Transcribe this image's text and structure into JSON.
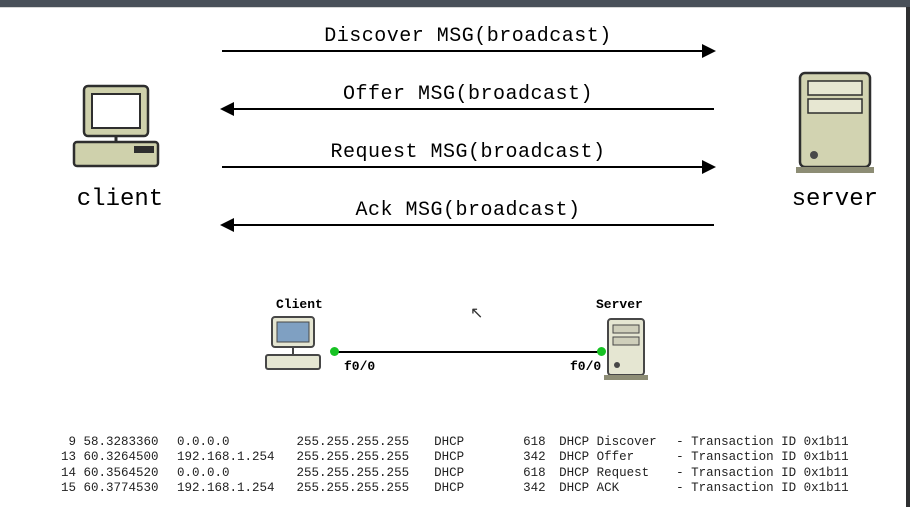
{
  "endpoints": {
    "client_label": "client",
    "server_label": "server"
  },
  "arrows": [
    {
      "label": "Discover MSG(broadcast)",
      "dir": "right"
    },
    {
      "label": "Offer MSG(broadcast)",
      "dir": "left"
    },
    {
      "label": "Request MSG(broadcast)",
      "dir": "right"
    },
    {
      "label": "Ack MSG(broadcast)",
      "dir": "left"
    }
  ],
  "mini": {
    "client_label": "Client",
    "server_label": "Server",
    "iface_left": "f0/0",
    "iface_right": "f0/0"
  },
  "capture": [
    {
      "no": "9",
      "time": "58.3283360",
      "src": "0.0.0.0",
      "dst": "255.255.255.255",
      "proto": "DHCP",
      "len": "618",
      "type": "Discover",
      "txid": "0x1b11"
    },
    {
      "no": "13",
      "time": "60.3264500",
      "src": "192.168.1.254",
      "dst": "255.255.255.255",
      "proto": "DHCP",
      "len": "342",
      "type": "Offer",
      "txid": "0x1b11"
    },
    {
      "no": "14",
      "time": "60.3564520",
      "src": "0.0.0.0",
      "dst": "255.255.255.255",
      "proto": "DHCP",
      "len": "618",
      "type": "Request",
      "txid": "0x1b11"
    },
    {
      "no": "15",
      "time": "60.3774530",
      "src": "192.168.1.254",
      "dst": "255.255.255.255",
      "proto": "DHCP",
      "len": "342",
      "type": "ACK",
      "txid": "0x1b11"
    }
  ]
}
